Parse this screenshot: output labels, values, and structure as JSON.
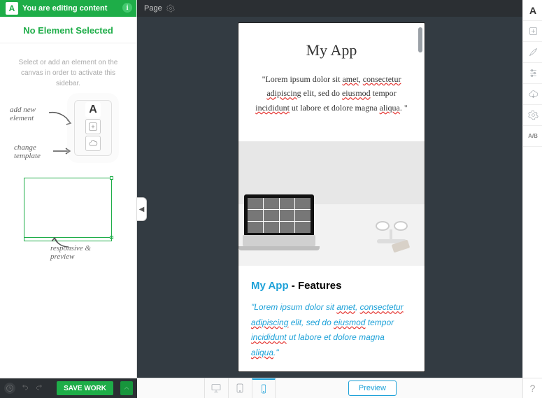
{
  "sidebar": {
    "status": "You are editing content",
    "title": "No Element Selected",
    "help": "Select or add an element on the canvas in order to activate this sidebar.",
    "hints": {
      "add": "add new element",
      "change": "change template",
      "responsive": "responsive & preview"
    }
  },
  "toolbar": {
    "page_label": "Page"
  },
  "device_content": {
    "title": "My App",
    "paragraph_quote_open": "\"",
    "paragraph_parts": {
      "p1": "Lorem ipsum dolor sit ",
      "amet": "amet",
      "p2": ", ",
      "consectetur": "consectetur",
      "sp": " ",
      "adipiscing": "adipiscing",
      "p3": " elit, sed do ",
      "eiusmod": "eiusmod",
      "p4": " tempor ",
      "incididunt": "incididunt",
      "p5": " ut labore et dolore magna ",
      "aliqua": "aliqua",
      "p6": ". \""
    },
    "sub_title_blue": "My App",
    "sub_title_rest": " - Features",
    "sub_para": {
      "q": "\"Lorem ipsum dolor sit ",
      "amet": "amet",
      "c1": ", ",
      "consectetur": "consectetur",
      "sp": " ",
      "adipiscing": "adipiscing",
      "c2": " elit, sed do ",
      "eiusmod": "eiusmod",
      "c3": " tempor ",
      "incididunt": "incididunt",
      "c4": " ut labore et dolore magna ",
      "aliqua": "aliqua",
      "c5": ".\""
    }
  },
  "bottom": {
    "save": "SAVE WORK",
    "preview": "Preview"
  },
  "rail": {
    "ab": "A/B"
  }
}
